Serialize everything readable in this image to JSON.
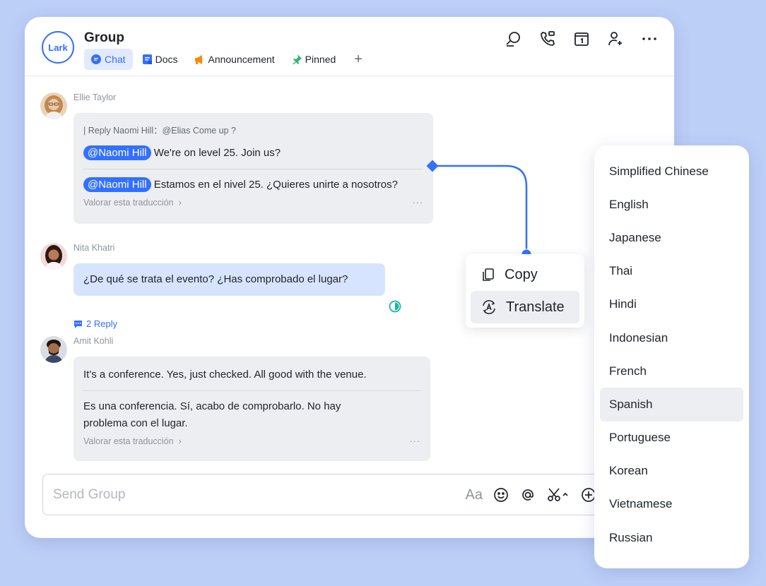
{
  "app": {
    "logo_text": "Lark"
  },
  "header": {
    "title": "Group",
    "tabs": [
      {
        "label": "Chat",
        "icon": "chat-icon",
        "active": true
      },
      {
        "label": "Docs",
        "icon": "docs-icon",
        "active": false
      },
      {
        "label": "Announcement",
        "icon": "megaphone-icon",
        "active": false
      },
      {
        "label": "Pinned",
        "icon": "pin-icon",
        "active": false
      }
    ],
    "add_tab_label": "+",
    "actions": [
      "search-icon",
      "phone-icon",
      "calendar-icon",
      "add-member-icon",
      "more-icon"
    ]
  },
  "messages": [
    {
      "sender": "Ellie Taylor",
      "reply_quote": "| Reply Naomi Hill：@Elias Come up ?",
      "mention": "@Naomi Hill",
      "original_text": "We're on level 25. Join us?",
      "translated_mention": "@Naomi Hill",
      "translated_text": "Estamos en el nivel 25. ¿Quieres unirte a nosotros?",
      "rate_label": "Valorar esta traducción",
      "more": "···"
    },
    {
      "sender": "Nita Khatri",
      "text": "¿De qué se trata el evento? ¿Has comprobado el lugar?",
      "reply_count": "2 Reply"
    },
    {
      "sender": "Amit Kohli",
      "original_text": "It's a conference. Yes, just checked. All good with the venue.",
      "translated_line1": "Es una conferencia. Sí, acabo de comprobarlo. No hay",
      "translated_line2": "problema con el lugar.",
      "rate_label": "Valorar esta traducción",
      "more": "···"
    }
  ],
  "composer": {
    "placeholder": "Send Group",
    "font_label": "Aa"
  },
  "context_menu": {
    "items": [
      {
        "label": "Copy",
        "icon": "copy-icon"
      },
      {
        "label": "Translate",
        "icon": "translate-icon",
        "active": true
      }
    ]
  },
  "languages": {
    "items": [
      "Simplified Chinese",
      "English",
      "Japanese",
      "Thai",
      "Hindi",
      "Indonesian",
      "French",
      "Spanish",
      "Portuguese",
      "Korean",
      "Vietnamese",
      "Russian"
    ],
    "selected": "Spanish"
  },
  "colors": {
    "accent": "#3370ff",
    "background": "#bccff7",
    "bubble": "#eceef1",
    "bubble_blue": "#d6e4ff"
  }
}
